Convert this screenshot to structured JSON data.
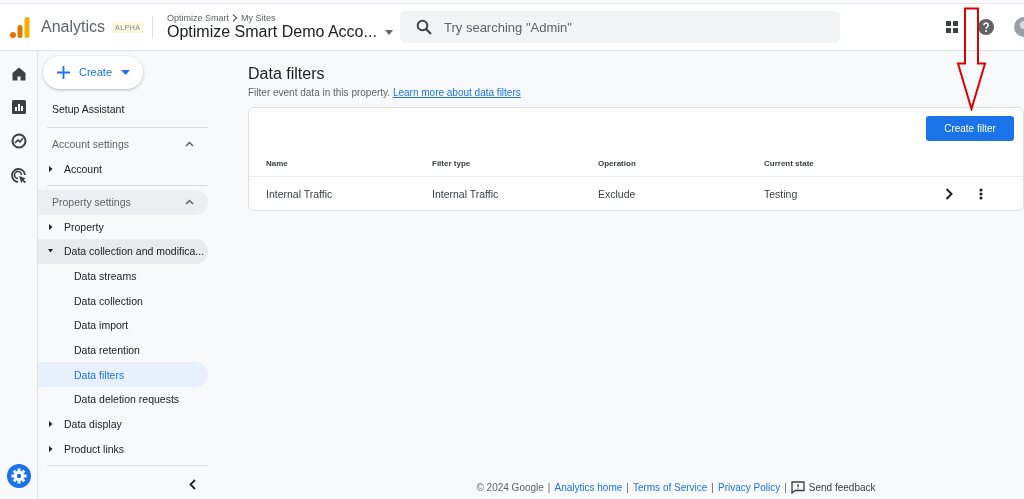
{
  "header": {
    "product": "Analytics",
    "badge": "ALPHA",
    "breadcrumb": [
      "Optimize Smart",
      "My Sites"
    ],
    "account": "Optimize Smart Demo Acco...",
    "search": {
      "placeholder": "Try searching \"Admin\""
    }
  },
  "sidebar": {
    "create_button": "Create",
    "top_items": [
      {
        "label": "Setup Assistant"
      }
    ],
    "sections": [
      {
        "title": "Account settings",
        "expanded": true,
        "highlighted": false,
        "items": [
          {
            "label": "Account",
            "expanded": false
          }
        ]
      },
      {
        "title": "Property settings",
        "expanded": true,
        "highlighted": true,
        "items": [
          {
            "label": "Property",
            "expanded": false
          },
          {
            "label": "Data collection and modifica...",
            "expanded": true,
            "children": [
              {
                "label": "Data streams",
                "selected": false
              },
              {
                "label": "Data collection",
                "selected": false
              },
              {
                "label": "Data import",
                "selected": false
              },
              {
                "label": "Data retention",
                "selected": false
              },
              {
                "label": "Data filters",
                "selected": true
              },
              {
                "label": "Data deletion requests",
                "selected": false
              }
            ]
          },
          {
            "label": "Data display",
            "expanded": false
          },
          {
            "label": "Product links",
            "expanded": false
          }
        ]
      }
    ]
  },
  "page": {
    "title": "Data filters",
    "description": "Filter event data in this property.",
    "link": "Learn more about data filters",
    "create_button": "Create filter",
    "table": {
      "columns": [
        "Name",
        "Filter type",
        "Operation",
        "Current state"
      ],
      "rows": [
        [
          "Internal Traffic",
          "Internal Traffic",
          "Exclude",
          "Testing"
        ]
      ]
    }
  },
  "footer": {
    "copyright": "© 2024 Google",
    "separators": [
      "|",
      "|",
      "|",
      "|"
    ],
    "links": [
      "Analytics home",
      "Terms of Service",
      "Privacy Policy"
    ],
    "feedback": "Send feedback"
  }
}
